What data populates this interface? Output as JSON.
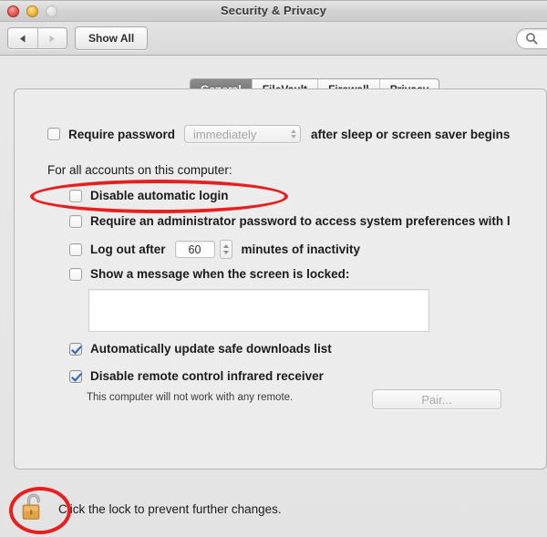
{
  "window": {
    "title": "Security & Privacy",
    "controls": [
      {
        "name": "close",
        "label": ""
      },
      {
        "name": "minimize",
        "label": ""
      },
      {
        "name": "zoom",
        "label": ""
      }
    ]
  },
  "toolbar": {
    "back_label": "◀",
    "forward_label": "▶",
    "show_all_label": "Show All",
    "search_placeholder": "",
    "search_value": "",
    "search_icon": "search-icon"
  },
  "tabs": [
    {
      "label": "General",
      "active": true
    },
    {
      "label": "FileVault",
      "active": false
    },
    {
      "label": "Firewall",
      "active": false
    },
    {
      "label": "Privacy",
      "active": false
    }
  ],
  "general": {
    "require_password": {
      "checkbox_label": "Require password",
      "checked": false,
      "popup_value": "immediately",
      "popup_enabled": false,
      "trailing_label": "after sleep or screen saver begins"
    },
    "section_heading": "For all accounts on this computer:",
    "disable_automatic_login": {
      "label": "Disable automatic login",
      "checked": false
    },
    "require_admin_password": {
      "label": "Require an administrator password to access system preferences with l",
      "checked": false
    },
    "log_out_after": {
      "label": "Log out after",
      "checked": false,
      "value": "60",
      "trailing_label": "minutes of inactivity"
    },
    "show_message": {
      "label": "Show a message when the screen is locked:",
      "checked": false,
      "message_value": "",
      "message_placeholder": ""
    },
    "auto_update_downloads": {
      "label": "Automatically update safe downloads list",
      "checked": true
    },
    "disable_infrared": {
      "label": "Disable remote control infrared receiver",
      "checked": true
    },
    "remote_note": "This computer will not work with any remote.",
    "pair_button": {
      "label": "Pair...",
      "enabled": false
    }
  },
  "footer": {
    "lock_icon": "unlocked-padlock-icon",
    "lock_caption": "Click the lock to prevent further changes."
  },
  "annotations": [
    {
      "name": "highlight-disable-automatic-login",
      "shape": "oval",
      "color": "#e81f1f"
    },
    {
      "name": "highlight-lock",
      "shape": "oval",
      "color": "#e81f1f"
    }
  ],
  "colors": {
    "annotation_red": "#e81f1f",
    "checkmark_blue": "#2a64b8",
    "lock_gold": "#e8a33d",
    "active_tab_gray": "#7c7c7c"
  }
}
